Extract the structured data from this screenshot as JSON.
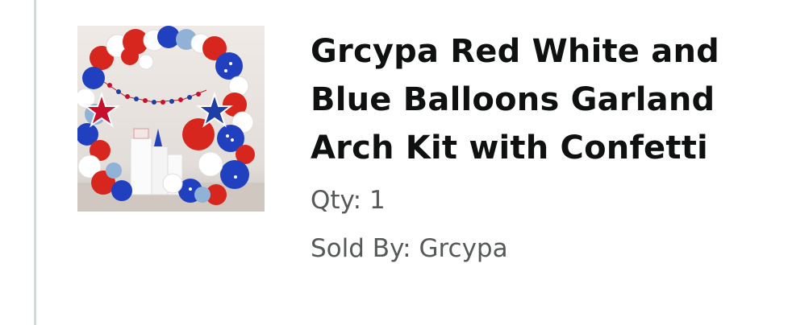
{
  "product": {
    "title_lines": [
      "Grcypa Red White and",
      "Blue Balloons Garland",
      "Arch Kit with Confetti"
    ],
    "qty_label": "Qty:",
    "qty_value": "1",
    "seller_label": "Sold By:",
    "seller_name": "Grcypa",
    "image_icon": "balloon-arch-product-image"
  },
  "colors": {
    "title": "#0f1111",
    "meta": "#565959",
    "divider": "#d5d9d9"
  }
}
